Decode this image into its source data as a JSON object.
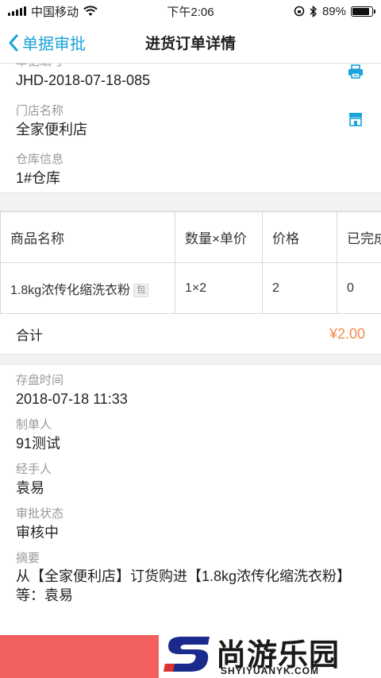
{
  "status_bar": {
    "carrier": "中国移动",
    "time": "下午2:06",
    "battery_percent": "89%",
    "battery_level": 0.89
  },
  "nav": {
    "back_label": "单据审批",
    "title": "进货订单详情"
  },
  "order_info": {
    "doc_no_label": "单据编号",
    "doc_no": "JHD-2018-07-18-085",
    "store_label": "门店名称",
    "store": "全家便利店",
    "warehouse_label": "仓库信息",
    "warehouse": "1#仓库"
  },
  "goods_table": {
    "headers": [
      "商品名称",
      "数量×单价",
      "价格",
      "已完成"
    ],
    "rows": [
      {
        "name": "1.8kg浓传化缩洗衣粉",
        "tag": "包",
        "qty_price": "1×2",
        "price": "2",
        "done": "0"
      }
    ]
  },
  "total": {
    "label": "合计",
    "amount": "¥2.00"
  },
  "details": {
    "check_time_label": "存盘时间",
    "check_time": "2018-07-18 11:33",
    "creator_label": "制单人",
    "creator": "91测试",
    "handler_label": "经手人",
    "handler": "袁易",
    "status_label": "审批状态",
    "status": "审核中",
    "summary_label": "摘要",
    "summary": "从【全家便利店】订货购进【1.8kg浓传化缩洗衣粉】等：袁易"
  },
  "watermark": {
    "cn": "尚游乐园",
    "en": "SHYIYUANYK.COM"
  },
  "colors": {
    "accent": "#1aa3d9",
    "amount": "#f58a49"
  }
}
